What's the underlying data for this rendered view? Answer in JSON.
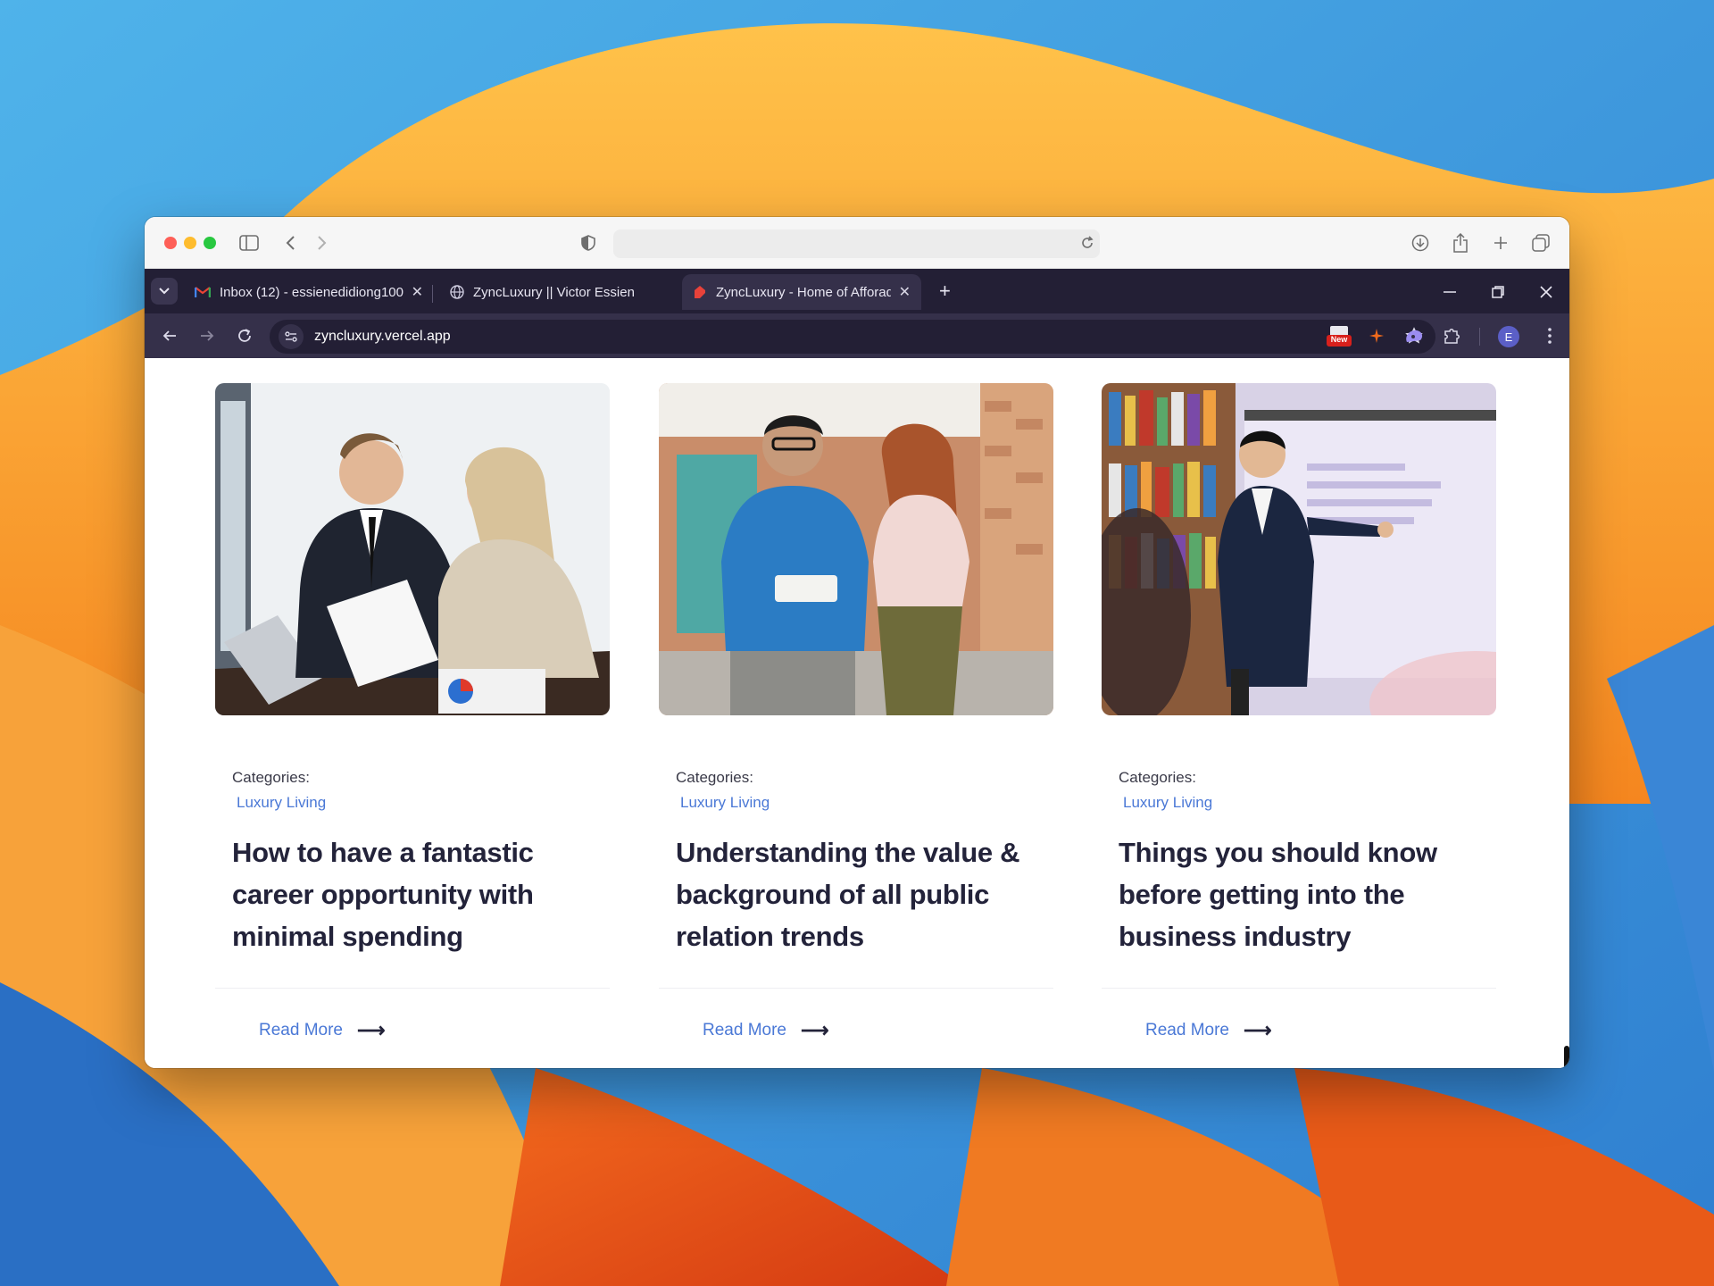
{
  "colors": {
    "chrome_frame": "#231f35",
    "chrome_toolbar": "#35304a",
    "link_blue": "#4a78d6",
    "heading_dark": "#23233a"
  },
  "safari": {
    "icons": [
      "sidebar-icon",
      "back-icon",
      "forward-icon",
      "shield-icon",
      "reload-icon",
      "download-icon",
      "share-icon",
      "plus-icon",
      "tabs-overview-icon"
    ]
  },
  "chrome": {
    "tabs": [
      {
        "title": "Inbox (12) - essienedidiong100",
        "favicon": "gmail-icon",
        "active": false
      },
      {
        "title": "ZyncLuxury || Victor Essien",
        "favicon": "globe-icon",
        "active": false
      },
      {
        "title": "ZyncLuxury - Home of Afforadb",
        "favicon": "zync-icon",
        "active": true
      }
    ],
    "url": "zyncluxury.vercel.app",
    "profile_initial": "E",
    "extension_badge": "New"
  },
  "posts": [
    {
      "category_label": "Categories:",
      "category": "Luxury Living",
      "title": "How to have a fantastic career opportunity with minimal spending",
      "read_more": "Read More"
    },
    {
      "category_label": "Categories:",
      "category": "Luxury Living",
      "title": "Understanding the value & background of all public relation trends",
      "read_more": "Read More"
    },
    {
      "category_label": "Categories:",
      "category": "Luxury Living",
      "title": "Things you should know before getting into the business industry",
      "read_more": "Read More"
    }
  ]
}
